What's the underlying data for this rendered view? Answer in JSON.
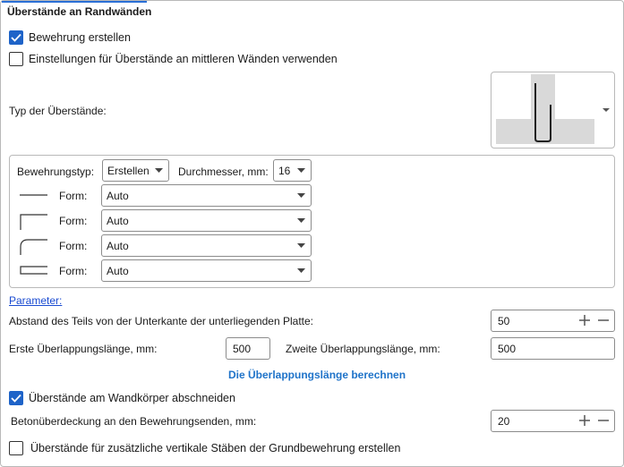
{
  "section": {
    "title": "Überstände an Randwänden"
  },
  "checkboxes": {
    "create_reinforcement": {
      "label": "Bewehrung erstellen",
      "checked": true
    },
    "use_middle_settings": {
      "label": "Einstellungen für Überstände an mittleren Wänden verwenden",
      "checked": false
    },
    "cut_at_wall": {
      "label": "Überstände am Wandkörper abschneiden",
      "checked": true
    },
    "additional_vertical": {
      "label": "Überstände für zusätzliche vertikale Stäben der Grundbewehrung erstellen",
      "checked": false
    }
  },
  "overhang_type": {
    "label": "Typ der Überstände:",
    "preview_icon": "u-shaped-bar-icon"
  },
  "group": {
    "type_label": "Bewehrungstyp:",
    "type_value": "Erstellen",
    "diameter_label": "Durchmesser, mm:",
    "diameter_value": "16",
    "forms": [
      {
        "icon": "straight-bar-icon",
        "label": "Form:",
        "value": "Auto"
      },
      {
        "icon": "l-hook-bar-icon",
        "label": "Form:",
        "value": "Auto"
      },
      {
        "icon": "curved-hook-bar-icon",
        "label": "Form:",
        "value": "Auto"
      },
      {
        "icon": "u-bar-icon",
        "label": "Form:",
        "value": "Auto"
      }
    ]
  },
  "parameters_link": "Parameter:",
  "distance": {
    "label": "Abstand des Teils von der Unterkante der unterliegenden Platte:",
    "value": "50"
  },
  "lap1": {
    "label": "Erste Überlappungslänge, mm:",
    "value": "500"
  },
  "lap2": {
    "label": "Zweite Überlappungslänge, mm:",
    "value": "500"
  },
  "calc_link": "Die Überlappungslänge berechnen",
  "cover": {
    "label": "Betonüberdeckung an den Bewehrungsenden, mm:",
    "value": "20"
  },
  "colors": {
    "accent": "#1e63c8",
    "link": "#1a4bd1"
  }
}
